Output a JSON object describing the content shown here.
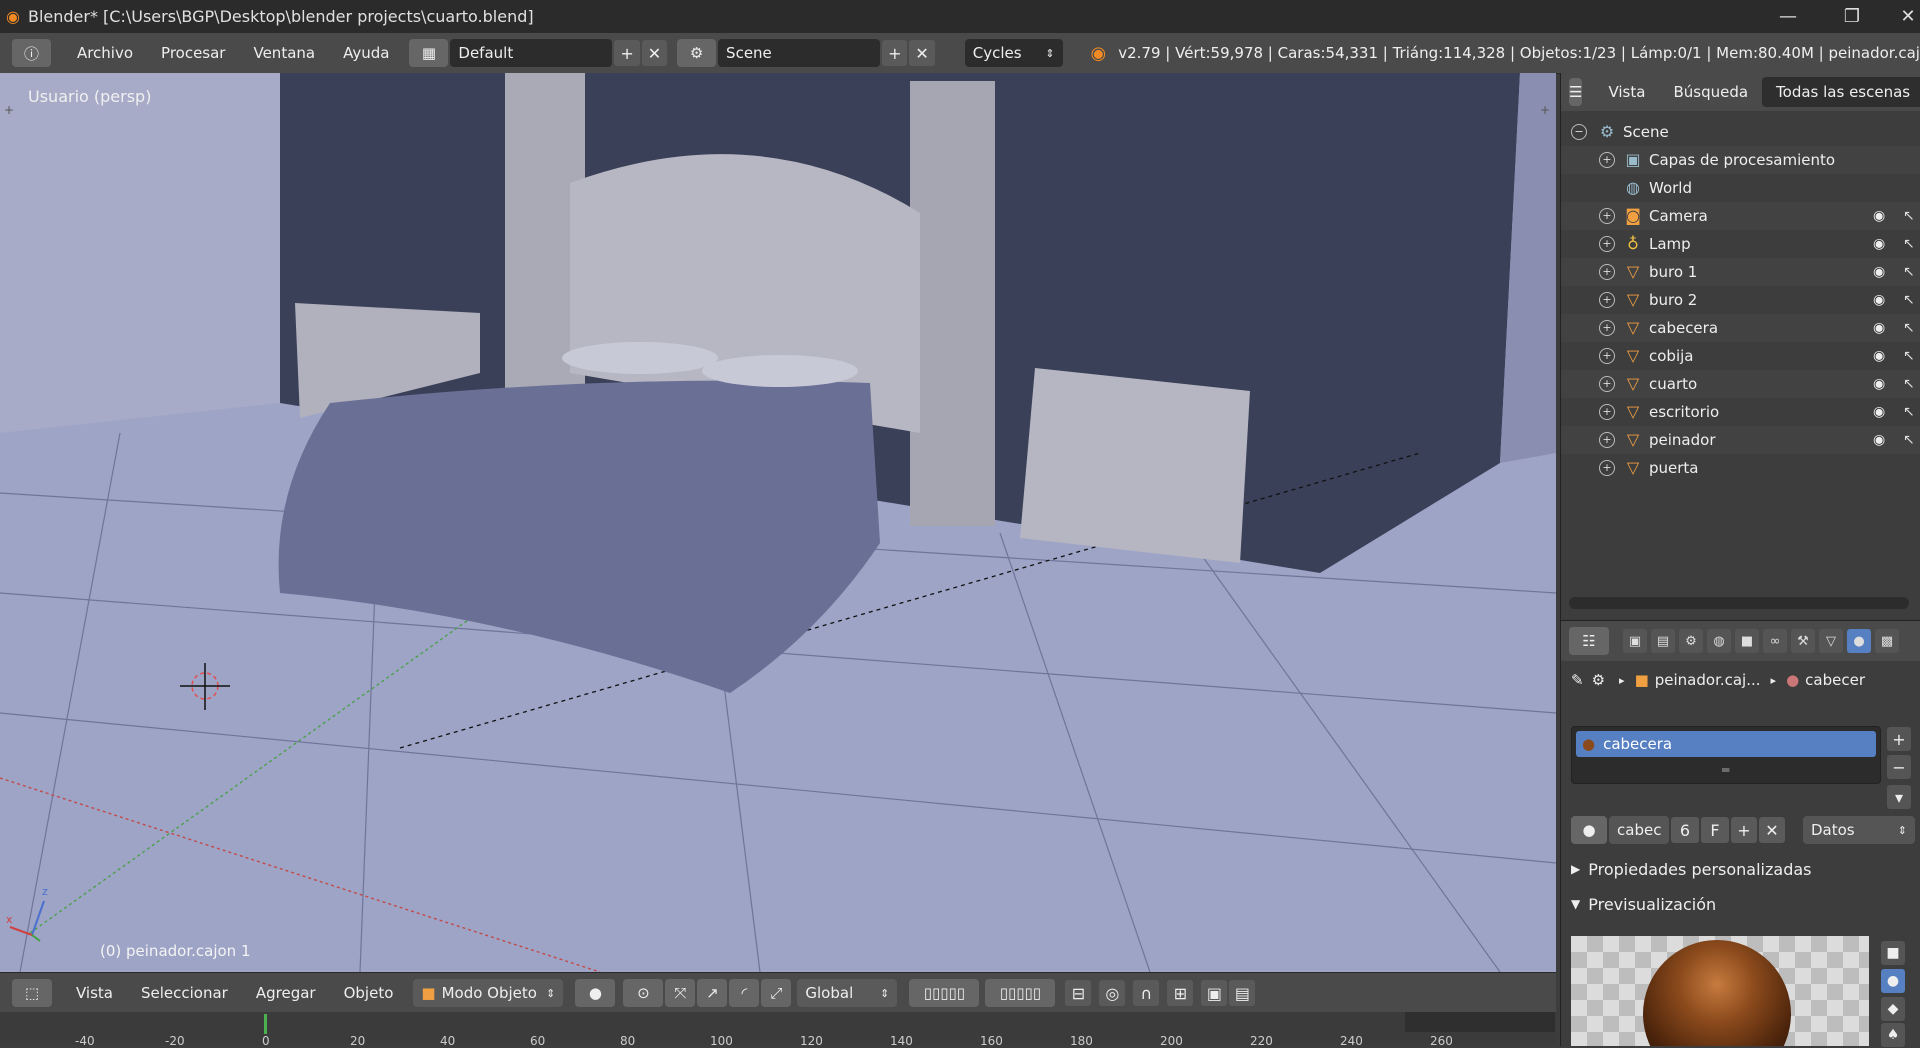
{
  "window": {
    "title": "Blender* [C:\\Users\\BGP\\Desktop\\blender projects\\cuarto.blend]",
    "minimize": "—",
    "restore": "❐",
    "close": "✕"
  },
  "topbar": {
    "menus": [
      "Archivo",
      "Procesar",
      "Ventana",
      "Ayuda"
    ],
    "screen_layout": "Default",
    "scene": "Scene",
    "render_engine": "Cycles",
    "stats": "v2.79 | Vért:59,978 | Caras:54,331 | Triáng:114,328 | Objetos:1/23 | Lámp:0/1 | Mem:80.40M | peinador.caj"
  },
  "viewport": {
    "label": "Usuario (persp)",
    "active_object": "(0) peinador.cajon 1",
    "axis_x": "x",
    "axis_z": "z"
  },
  "viewport_header": {
    "menus": [
      "Vista",
      "Seleccionar",
      "Agregar",
      "Objeto"
    ],
    "mode": "Modo Objeto",
    "orientation": "Global"
  },
  "timeline": {
    "ticks": [
      "-40",
      "-20",
      "0",
      "20",
      "40",
      "60",
      "80",
      "100",
      "120",
      "140",
      "160",
      "180",
      "200",
      "220",
      "240",
      "260"
    ]
  },
  "outliner": {
    "tabs": [
      "Vista",
      "Búsqueda",
      "Todas las escenas"
    ],
    "scene": "Scene",
    "render_layers": "Capas de procesamiento",
    "world": "World",
    "objects": [
      {
        "name": "Camera",
        "icon": "camera-icon"
      },
      {
        "name": "Lamp",
        "icon": "lamp-icon"
      },
      {
        "name": "buro 1",
        "icon": "mesh-icon"
      },
      {
        "name": "buro 2",
        "icon": "mesh-icon"
      },
      {
        "name": "cabecera",
        "icon": "mesh-icon"
      },
      {
        "name": "cobija",
        "icon": "mesh-icon"
      },
      {
        "name": "cuarto",
        "icon": "mesh-icon"
      },
      {
        "name": "escritorio",
        "icon": "mesh-icon"
      },
      {
        "name": "peinador",
        "icon": "mesh-icon"
      },
      {
        "name": "puerta",
        "icon": "mesh-icon"
      }
    ]
  },
  "properties": {
    "breadcrumb_object": "peinador.caj...",
    "breadcrumb_material": "cabecer",
    "material_slots": [
      "cabecera"
    ],
    "material_name": "cabec",
    "users": "6",
    "fake_user": "F",
    "link": "Datos",
    "panel_custom": "Propiedades personalizadas",
    "panel_preview": "Previsualización",
    "colors": {
      "selection": "#5680c2",
      "material": "#8b4a1c"
    }
  }
}
